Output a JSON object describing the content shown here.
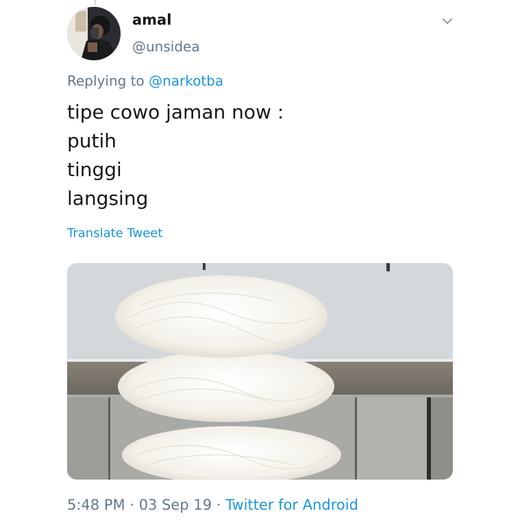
{
  "user": {
    "display_name": "amal",
    "handle": "@unsidea"
  },
  "reply": {
    "prefix": "Replying to",
    "mention": "@narkotba"
  },
  "tweet": {
    "lines": [
      "tipe cowo jaman now :",
      "putih",
      "tinggi",
      "langsing"
    ],
    "translate_label": "Translate Tweet"
  },
  "meta": {
    "time": "5:48 PM",
    "date": "03 Sep 19",
    "separator": "·",
    "source": "Twitter for Android"
  },
  "icons": {
    "menu": "chevron-down-icon"
  },
  "colors": {
    "link": "#1b95e0",
    "secondary_text": "#657786",
    "primary_text": "#14171a"
  }
}
